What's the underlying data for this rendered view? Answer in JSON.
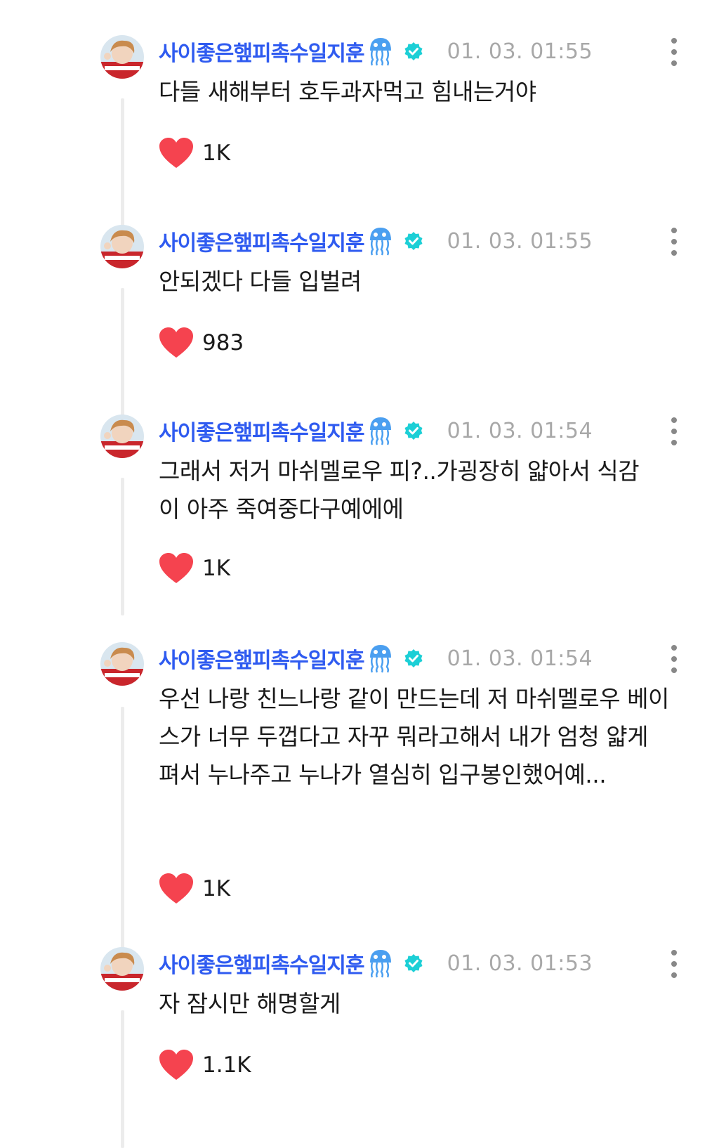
{
  "comments": [
    {
      "author": "사이좋은햎피촉수일지훈",
      "time": "01. 03. 01:55",
      "text": "다들 새해부터 호두과자먹고 힘내는거야",
      "likes": "1K"
    },
    {
      "author": "사이좋은햎피촉수일지훈",
      "time": "01. 03. 01:55",
      "text": "안되겠다 다들 입벌려",
      "likes": "983"
    },
    {
      "author": "사이좋은햎피촉수일지훈",
      "time": "01. 03. 01:54",
      "text": "그래서 저거 마쉬멜로우 피?..가굉장히 얇아서 식감이 아주 죽여중다구예에에",
      "likes": "1K"
    },
    {
      "author": "사이좋은햎피촉수일지훈",
      "time": "01. 03. 01:54",
      "text": "우선 나랑 친느나랑 같이 만드는데 저 마쉬멜로우 베이스가 너무 두껍다고 자꾸 뭐라고해서 내가 엄청 얇게 펴서 누나주고 누나가 열심히 입구봉인했어예...",
      "likes": "1K"
    },
    {
      "author": "사이좋은햎피촉수일지훈",
      "time": "01. 03. 01:53",
      "text": "자 잠시만 해명할게",
      "likes": "1.1K"
    }
  ],
  "icons": {
    "author_emoji": "jellyfish-icon",
    "verified": "verified-badge-icon",
    "more": "more-vertical-icon",
    "like": "heart-icon"
  },
  "colors": {
    "author": "#2f5bf0",
    "verified": "#1ccfd6",
    "time": "#a8a8a8",
    "heart": "#f5434f"
  }
}
